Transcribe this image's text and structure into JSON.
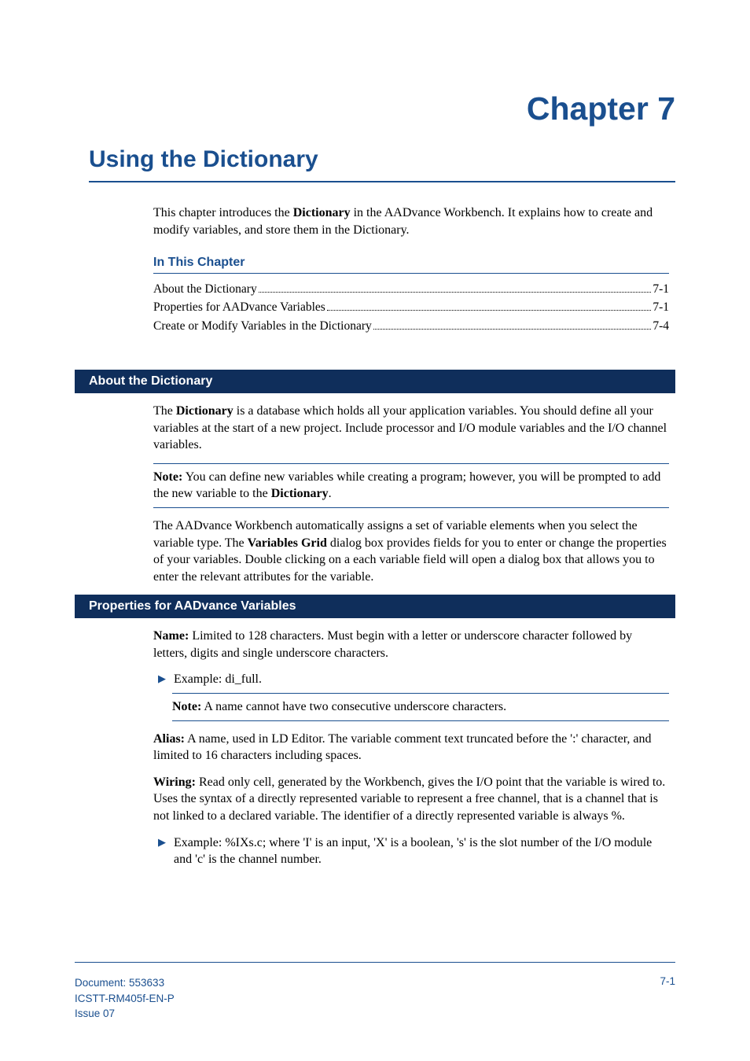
{
  "chapter_number": "Chapter 7",
  "chapter_title": "Using the Dictionary",
  "intro": "This chapter introduces the Dictionary in the AADvance Workbench. It explains how to create and modify variables, and store them in the Dictionary.",
  "intro_prefix": "This chapter introduces the ",
  "intro_bold1": "Dictionary",
  "intro_after1": " in the AADvance Workbench. It explains how to create and modify variables, and store them in the Dictionary.",
  "in_this_chapter_heading": "In This Chapter",
  "toc": [
    {
      "label": "About the Dictionary",
      "page": "7-1"
    },
    {
      "label": "Properties for AADvance Variables",
      "page": "7-1"
    },
    {
      "label": "Create or Modify Variables in the Dictionary",
      "page": "7-4"
    }
  ],
  "section1": {
    "title": "About the Dictionary",
    "p1_a": "The ",
    "p1_bold": "Dictionary",
    "p1_b": " is a database which holds all your application variables. You should define all your variables at the start of a new project. Include processor and I/O module variables and the I/O channel variables.",
    "note_label": "Note:",
    "note_a": " You can define new variables while creating a program; however, you will be prompted to add the new variable to the ",
    "note_bold": "Dictionary",
    "note_b": ".",
    "p2_a": "The AADvance Workbench automatically assigns a set of variable elements when you select the variable type. The ",
    "p2_bold": "Variables Grid",
    "p2_b": " dialog box provides fields for you to enter or change the properties of your variables. Double clicking on a each variable field will open a dialog box that allows you to enter the relevant attributes for the variable."
  },
  "section2": {
    "title": "Properties for AADvance Variables",
    "name_label": "Name:",
    "name_text": " Limited to 128 characters. Must begin with a letter or underscore character followed by letters, digits and single underscore characters.",
    "name_example": "Example: di_full.",
    "name_note_label": "Note:",
    "name_note_text": " A name cannot have two consecutive underscore characters.",
    "alias_label": "Alias:",
    "alias_text": " A name, used in LD Editor. The variable comment text truncated before the ':' character, and limited to 16 characters including spaces.",
    "wiring_label": "Wiring:",
    "wiring_text": " Read only cell, generated by the Workbench, gives the I/O point that the variable is wired to. Uses the syntax of a directly represented variable to represent a free channel, that is a channel that is not linked to a declared variable. The identifier of a directly represented variable is always %.",
    "wiring_example": "Example: %IXs.c; where 'I' is an input, 'X' is a boolean, 's' is the slot number of the I/O module and 'c' is the channel number."
  },
  "footer": {
    "doc_line1": "Document: 553633",
    "doc_line2": "ICSTT-RM405f-EN-P",
    "doc_line3": "Issue 07",
    "page": "7-1"
  }
}
